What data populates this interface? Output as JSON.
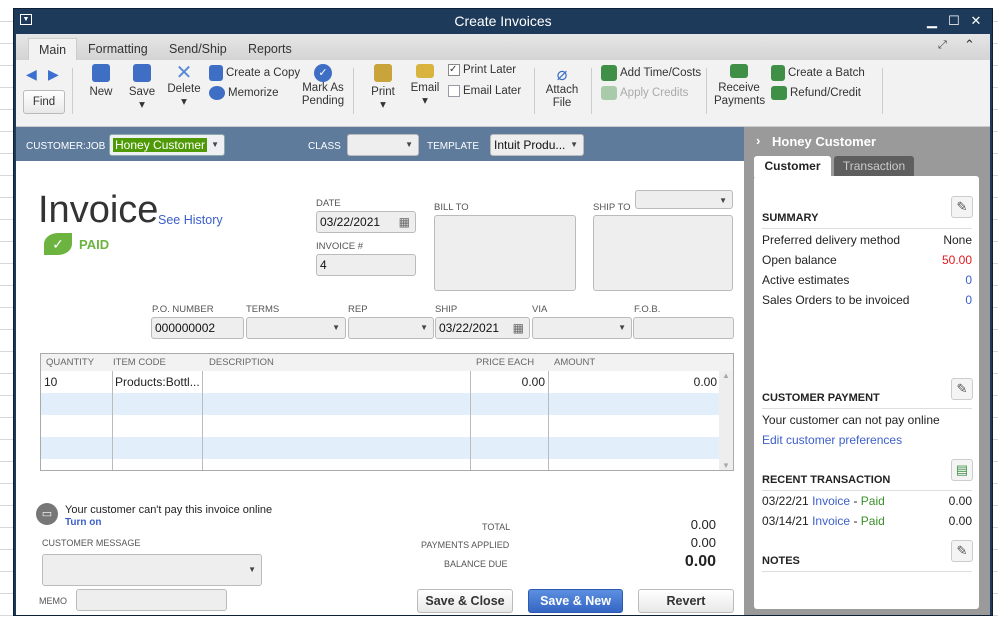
{
  "window": {
    "title": "Create Invoices"
  },
  "tabs": [
    "Main",
    "Formatting",
    "Send/Ship",
    "Reports"
  ],
  "ribbon": {
    "find": "Find",
    "new": "New",
    "save": "Save",
    "delete": "Delete",
    "create_copy": "Create a Copy",
    "memorize": "Memorize",
    "mark_pending": "Mark As Pending",
    "print": "Print",
    "email": "Email",
    "print_later": "Print Later",
    "print_later_checked": true,
    "email_later": "Email Later",
    "email_later_checked": false,
    "attach_file": "Attach File",
    "add_time_costs": "Add Time/Costs",
    "apply_credits": "Apply Credits",
    "receive_payments": "Receive Payments",
    "create_batch": "Create a Batch",
    "refund_credit": "Refund/Credit"
  },
  "header": {
    "customer_job_label": "CUSTOMER:JOB",
    "customer_job": "Honey Customer",
    "class_label": "CLASS",
    "class": "",
    "template_label": "TEMPLATE",
    "template": "Intuit Produ..."
  },
  "invoice": {
    "title": "Invoice",
    "see_history": "See History",
    "status": "PAID",
    "date_label": "DATE",
    "date": "03/22/2021",
    "invoice_no_label": "INVOICE #",
    "invoice_no": "4",
    "bill_to_label": "BILL TO",
    "ship_to_label": "SHIP TO",
    "po_label": "P.O. NUMBER",
    "po": "000000002",
    "terms_label": "TERMS",
    "rep_label": "REP",
    "ship_label": "SHIP",
    "ship": "03/22/2021",
    "via_label": "VIA",
    "fob_label": "F.O.B."
  },
  "table": {
    "headers": [
      "QUANTITY",
      "ITEM CODE",
      "DESCRIPTION",
      "PRICE EACH",
      "AMOUNT"
    ],
    "rows": [
      {
        "qty": "10",
        "item": "Products:Bottl...",
        "desc": "",
        "price": "0.00",
        "amount": "0.00"
      }
    ]
  },
  "footer": {
    "online_msg": "Your customer can't pay this invoice online",
    "turn_on": "Turn on",
    "customer_message_label": "CUSTOMER MESSAGE",
    "memo_label": "MEMO",
    "total_label": "TOTAL",
    "total": "0.00",
    "payments_label": "PAYMENTS APPLIED",
    "payments": "0.00",
    "balance_label": "BALANCE DUE",
    "balance": "0.00",
    "save_close": "Save & Close",
    "save_new": "Save & New",
    "revert": "Revert"
  },
  "panel": {
    "name": "Honey Customer",
    "tabs": [
      "Customer",
      "Transaction"
    ],
    "summary_label": "SUMMARY",
    "summary": [
      {
        "k": "Preferred delivery method",
        "v": "None"
      },
      {
        "k": "Open balance",
        "v": "50.00"
      },
      {
        "k": "Active estimates",
        "v": "0"
      },
      {
        "k": "Sales Orders to be invoiced",
        "v": "0"
      }
    ],
    "payment_label": "CUSTOMER PAYMENT",
    "payment_text": "Your customer can not pay online",
    "edit_prefs": "Edit customer preferences",
    "recent_label": "RECENT TRANSACTION",
    "recent": [
      {
        "date": "03/22/21",
        "type": "Invoice",
        "sep": "-",
        "status": "Paid",
        "amount": "0.00"
      },
      {
        "date": "03/14/21",
        "type": "Invoice",
        "sep": "-",
        "status": "Paid",
        "amount": "0.00"
      }
    ],
    "notes_label": "NOTES"
  },
  "colors": {
    "accent": "#3b6fd0",
    "paid": "#6db33f",
    "red": "#e0191e",
    "header": "#5f7b9c"
  }
}
